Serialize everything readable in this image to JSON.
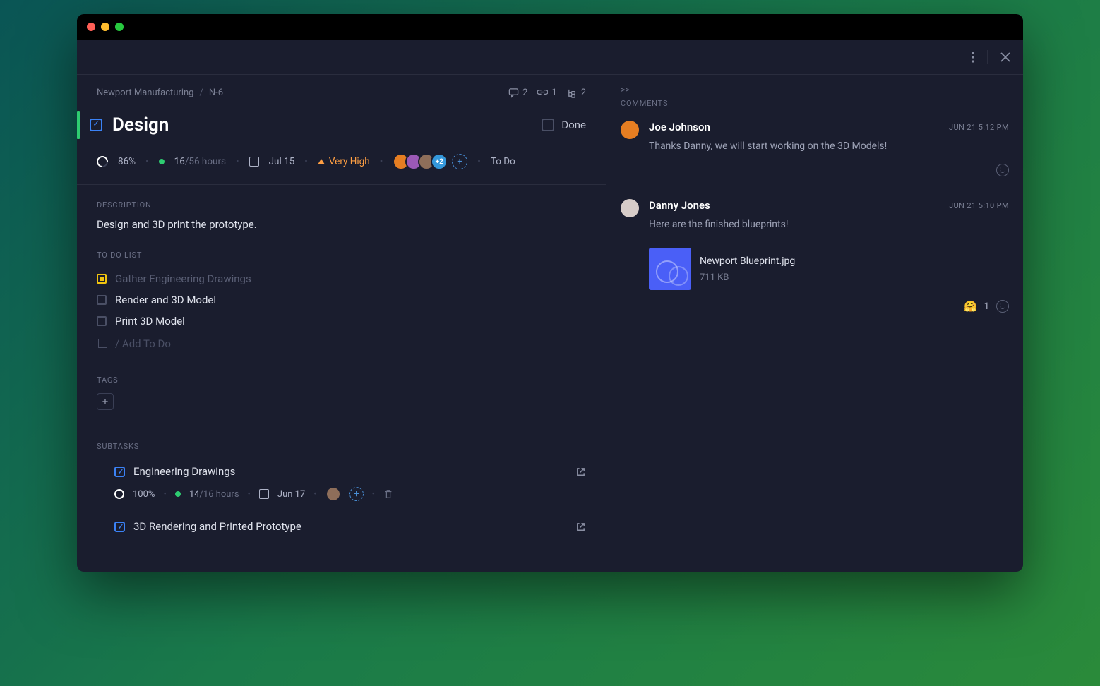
{
  "breadcrumbs": {
    "project": "Newport Manufacturing",
    "id": "N-6"
  },
  "stats": {
    "comments": "2",
    "links": "1",
    "subtasks": "2"
  },
  "title": "Design",
  "done_label": "Done",
  "meta": {
    "progress": "86%",
    "hours_spent": "16",
    "hours_total": "/56 hours",
    "due": "Jul 15",
    "priority": "Very High",
    "avatars_more": "+2",
    "status": "To Do"
  },
  "description": {
    "label": "Description",
    "text": "Design and 3D print the prototype."
  },
  "todo": {
    "label": "To Do List",
    "items": [
      {
        "text": "Gather Engineering Drawings",
        "done": true
      },
      {
        "text": "Render and 3D Model",
        "done": false
      },
      {
        "text": "Print 3D Model",
        "done": false
      }
    ],
    "add_placeholder": "/ Add To Do"
  },
  "tags": {
    "label": "Tags"
  },
  "subtasks": {
    "label": "Subtasks",
    "items": [
      {
        "title": "Engineering Drawings",
        "progress": "100%",
        "hours_spent": "14",
        "hours_total": "/16 hours",
        "due": "Jun 17"
      },
      {
        "title": "3D Rendering and Printed Prototype"
      }
    ]
  },
  "comments": {
    "label": "Comments",
    "items": [
      {
        "author": "Joe Johnson",
        "time": "Jun 21 5:12 PM",
        "text": "Thanks Danny, we will start working on the 3D Models!"
      },
      {
        "author": "Danny Jones",
        "time": "Jun 21 5:10 PM",
        "text": "Here are the finished blueprints!",
        "attachment": {
          "name": "Newport Blueprint.jpg",
          "size": "711 KB"
        },
        "reaction_count": "1"
      }
    ]
  }
}
